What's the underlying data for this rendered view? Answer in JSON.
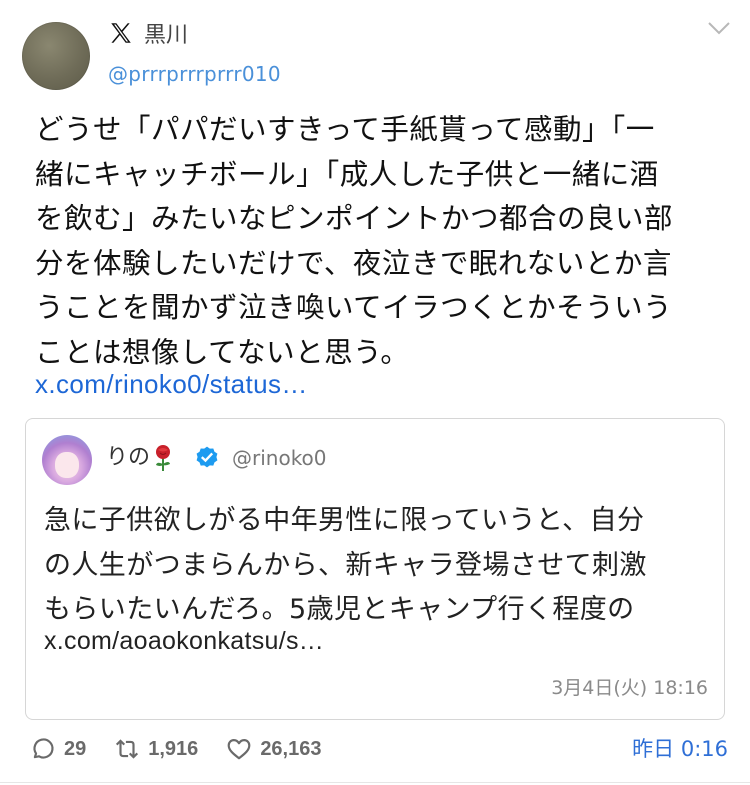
{
  "author": {
    "display_name": "黒川",
    "handle": "@prrrprrrprrr010",
    "avatar_icon": "avatar-image"
  },
  "tweet": {
    "text": "どうせ「パパだいすきって手紙貰って感動」「一\n緒にキャッチボール」「成人した子供と一緒に酒\nを飲む」みたいなピンポイントかつ都合の良い部\n分を体験したいだけで、夜泣きで眠れないとか言\nうことを聞かず泣き喚いてイラつくとかそういう\nことは想像してないと思う。",
    "link": "x.com/rinoko0/status…"
  },
  "quoted": {
    "display_name": "りの",
    "name_emoji": "rose-icon",
    "handle": "@rinoko0",
    "text": "急に子供欲しがる中年男性に限っていうと、自分\nの人生がつまらんから、新キャラ登場させて刺激\nもらいたいんだろ。5歳児とキャンプ行く程度の",
    "link": "x.com/aoaokonkatsu/s…",
    "time": "3月4日(火) 18:16"
  },
  "actions": {
    "replies": "29",
    "retweets": "1,916",
    "likes": "26,163"
  },
  "timestamp": "昨日 0:16",
  "colors": {
    "link": "#1d67d6",
    "handle": "#4a90d9",
    "verified": "#1d9bf0",
    "muted": "#6a6a6a"
  }
}
